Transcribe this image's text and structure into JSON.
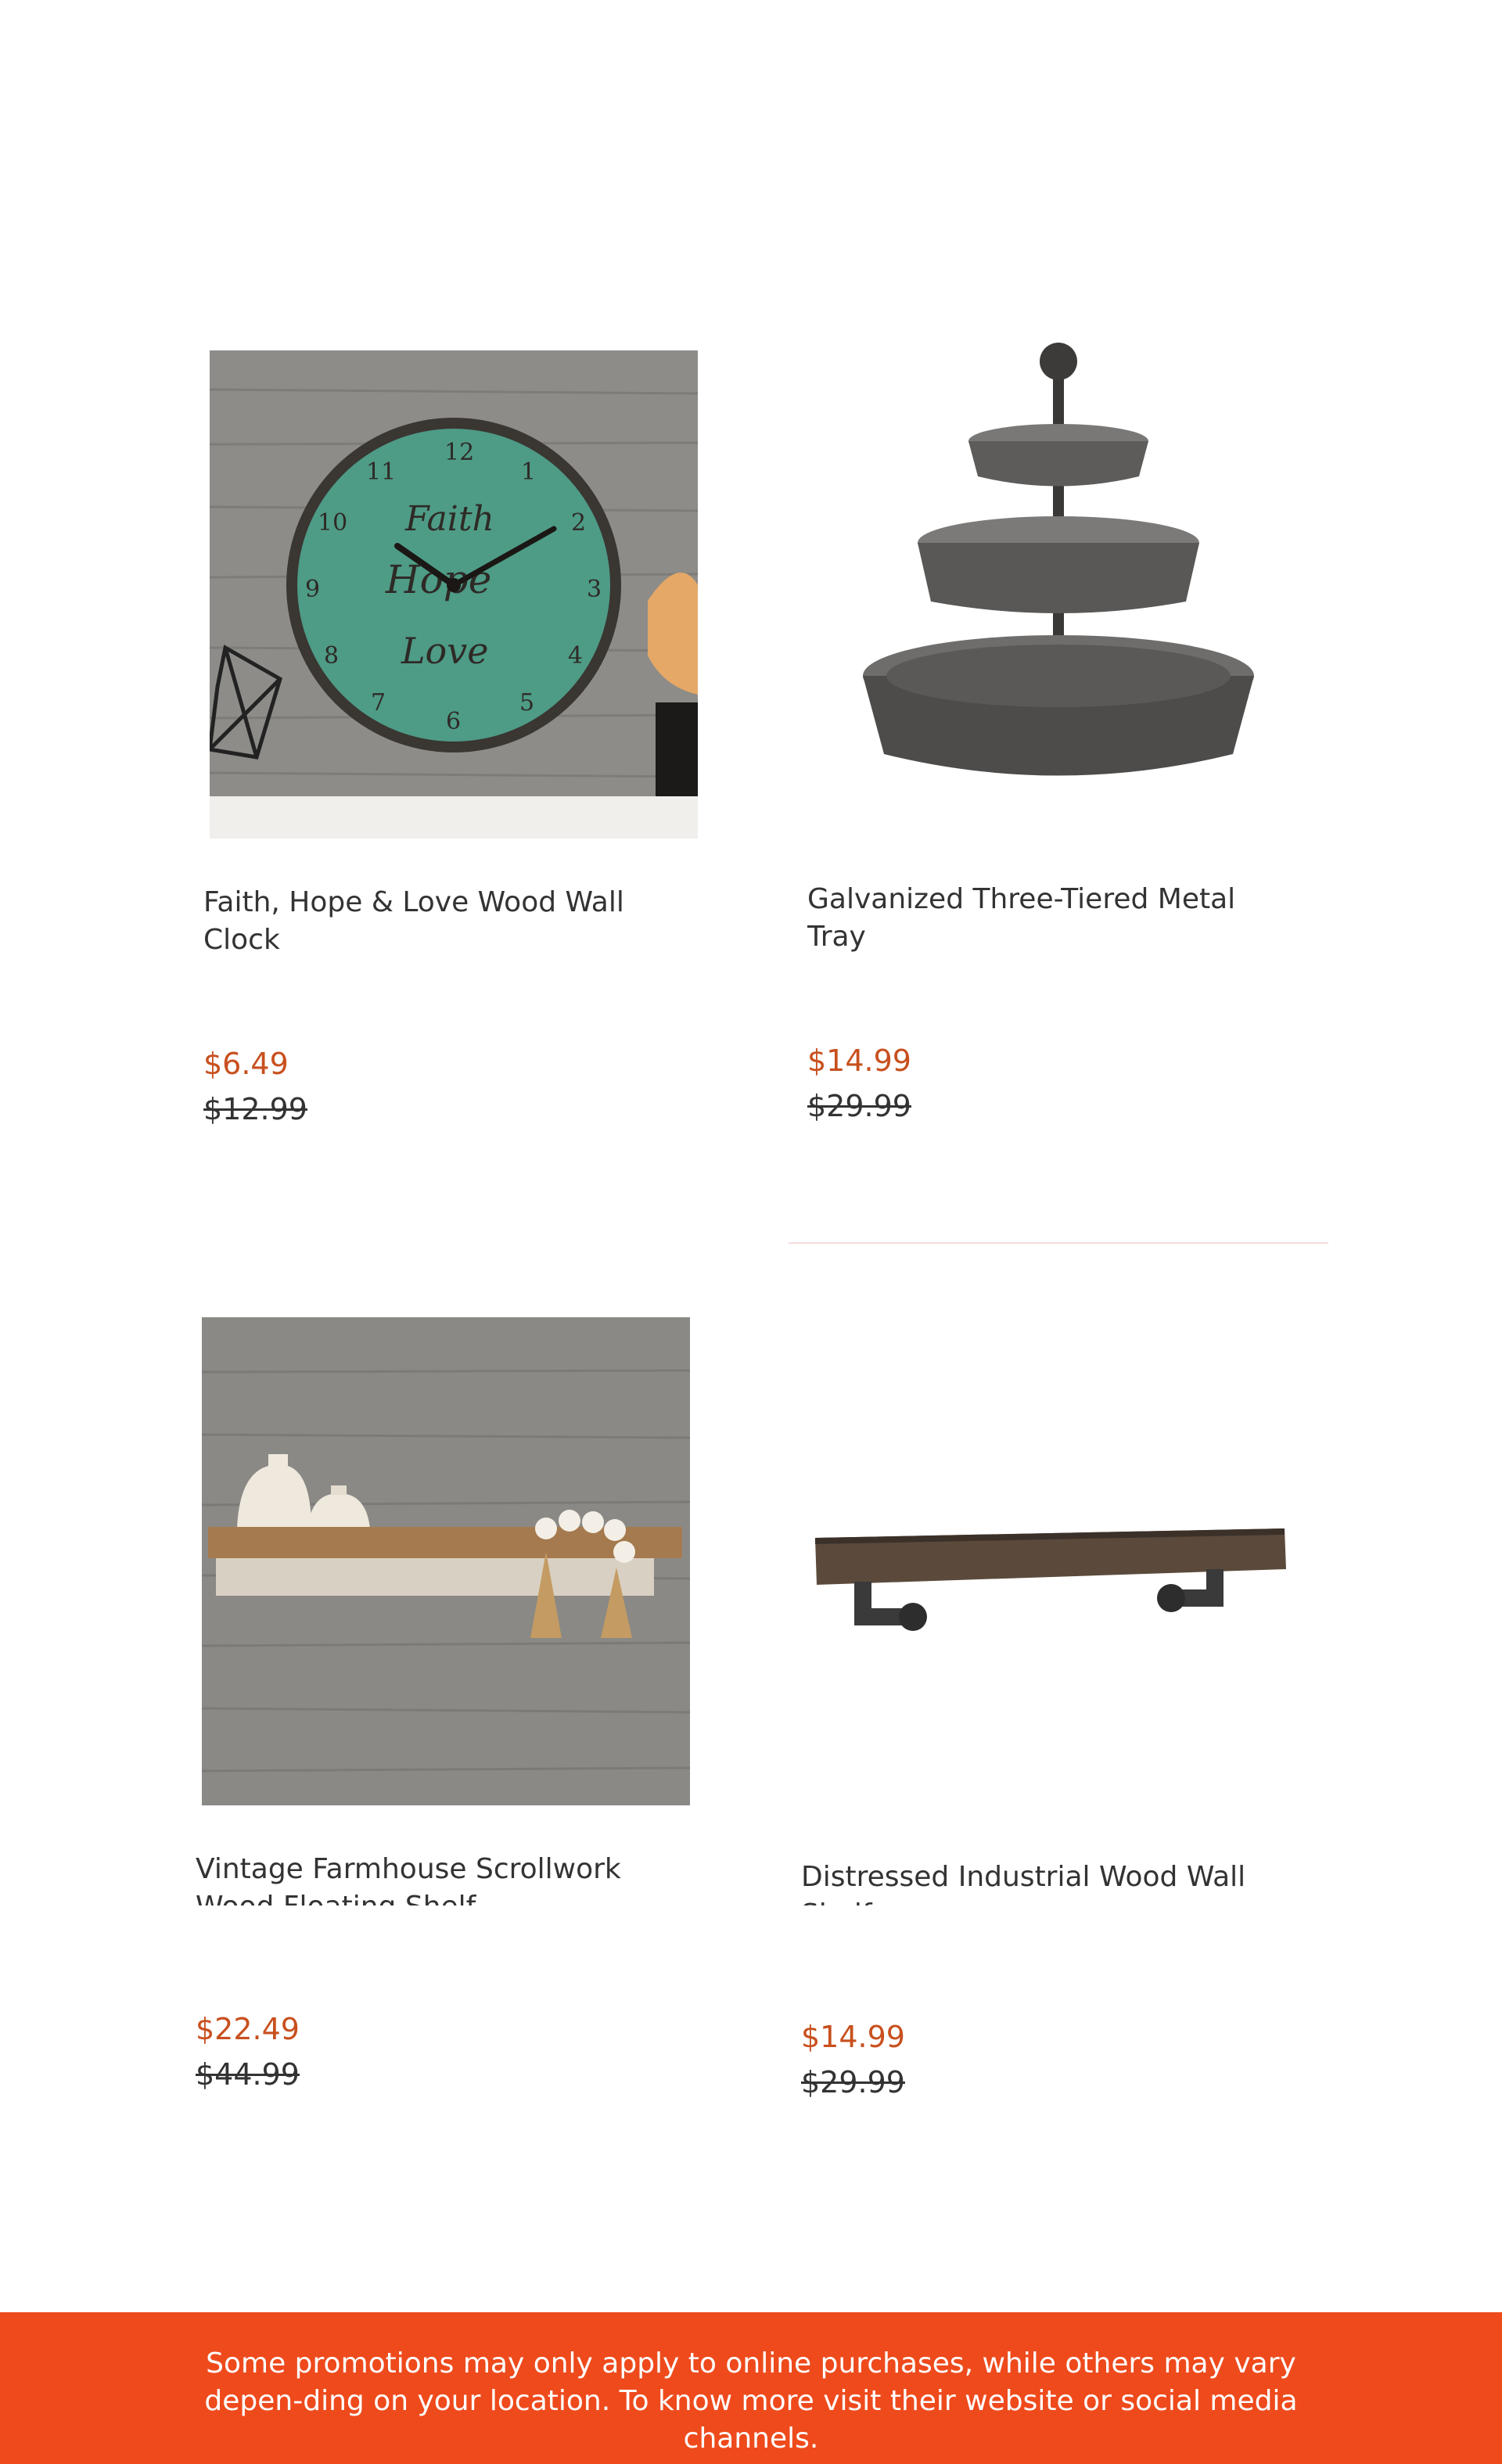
{
  "products": [
    {
      "title": "Faith, Hope & Love Wood Wall Clock",
      "sale_price": "$6.49",
      "original_price": "$12.99",
      "image": "wall-clock-image"
    },
    {
      "title": "Galvanized Three-Tiered Metal Tray",
      "sale_price": "$14.99",
      "original_price": "$29.99",
      "image": "metal-tray-image"
    },
    {
      "title": "Vintage Farmhouse Scrollwork Wood Floating Shelf",
      "sale_price": "$22.49",
      "original_price": "$44.99",
      "image": "floating-shelf-image"
    },
    {
      "title": "Distressed Industrial Wood Wall Shelf",
      "sale_price": "$14.99",
      "original_price": "$29.99",
      "image": "industrial-shelf-image"
    }
  ],
  "footer": {
    "text": "Some promotions may only apply to online purchases, while others may vary depen-ding on your location. To know more visit their website or social media channels."
  },
  "colors": {
    "sale_price": "#c8501e",
    "footer_background": "#ee4a1c",
    "footer_text": "#ffffff"
  }
}
